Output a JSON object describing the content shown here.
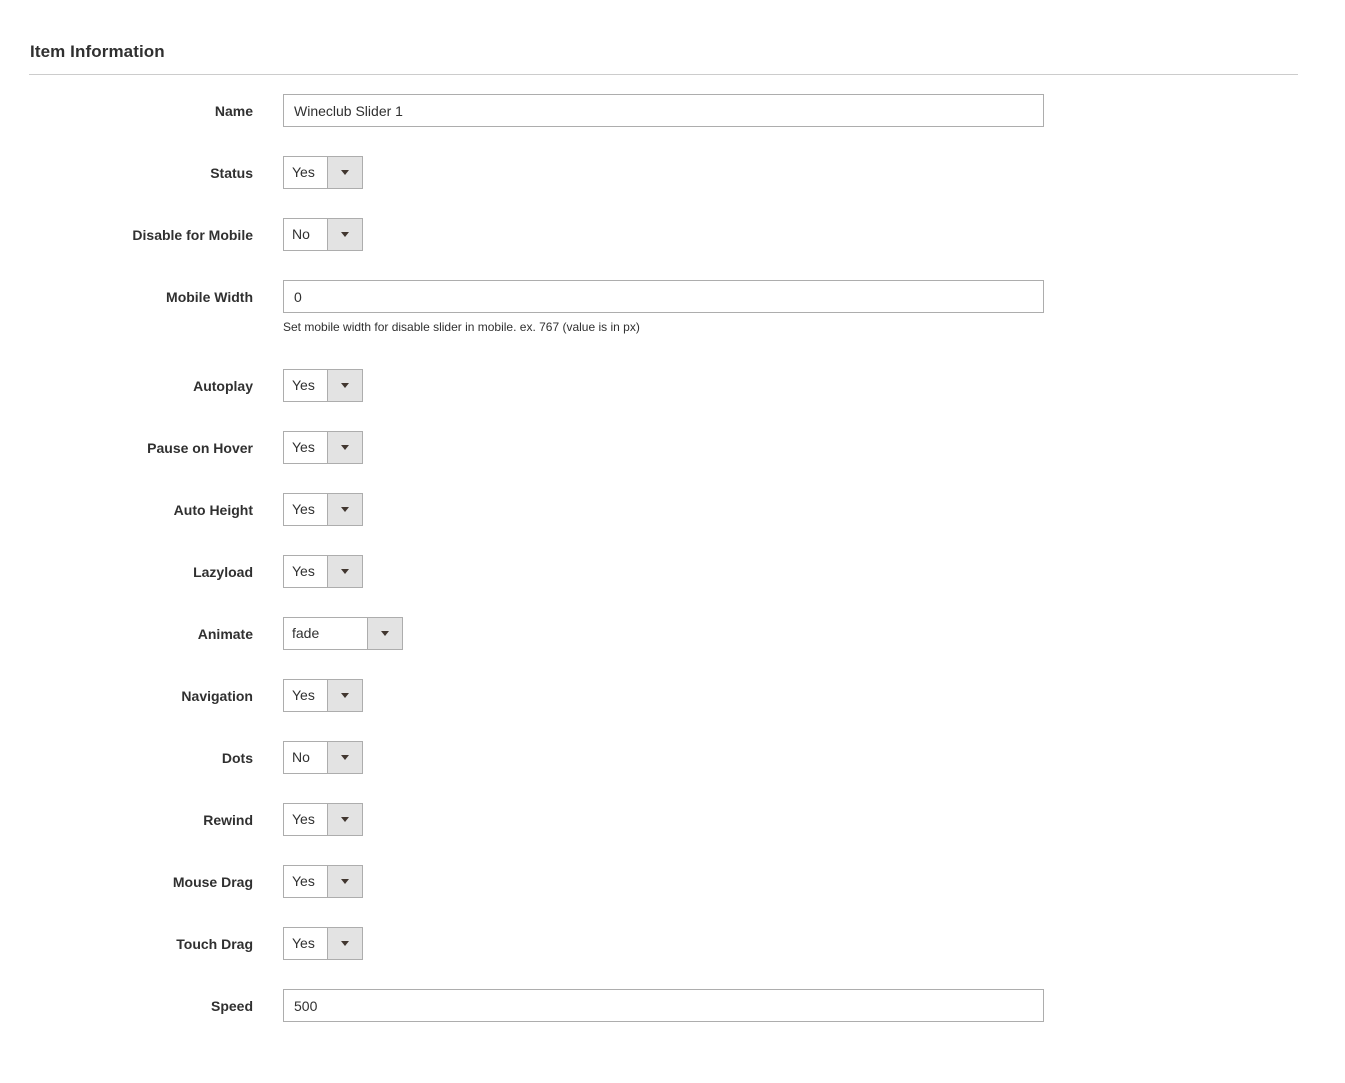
{
  "section": {
    "title": "Item Information"
  },
  "fields": {
    "name": {
      "label": "Name",
      "value": "Wineclub Slider 1"
    },
    "status": {
      "label": "Status",
      "value": "Yes"
    },
    "disable_mobile": {
      "label": "Disable for Mobile",
      "value": "No"
    },
    "mobile_width": {
      "label": "Mobile Width",
      "value": "0",
      "note": "Set mobile width for disable slider in mobile. ex. 767 (value is in px)"
    },
    "autoplay": {
      "label": "Autoplay",
      "value": "Yes"
    },
    "pause_hover": {
      "label": "Pause on Hover",
      "value": "Yes"
    },
    "auto_height": {
      "label": "Auto Height",
      "value": "Yes"
    },
    "lazyload": {
      "label": "Lazyload",
      "value": "Yes"
    },
    "animate": {
      "label": "Animate",
      "value": "fade"
    },
    "navigation": {
      "label": "Navigation",
      "value": "Yes"
    },
    "dots": {
      "label": "Dots",
      "value": "No"
    },
    "rewind": {
      "label": "Rewind",
      "value": "Yes"
    },
    "mouse_drag": {
      "label": "Mouse Drag",
      "value": "Yes"
    },
    "touch_drag": {
      "label": "Touch Drag",
      "value": "Yes"
    },
    "speed": {
      "label": "Speed",
      "value": "500"
    }
  },
  "icons": {
    "dropdown": "chevron-down-icon"
  },
  "colors": {
    "border": "#adadad",
    "arrow_bg": "#e3e3e3",
    "text": "#303030"
  }
}
